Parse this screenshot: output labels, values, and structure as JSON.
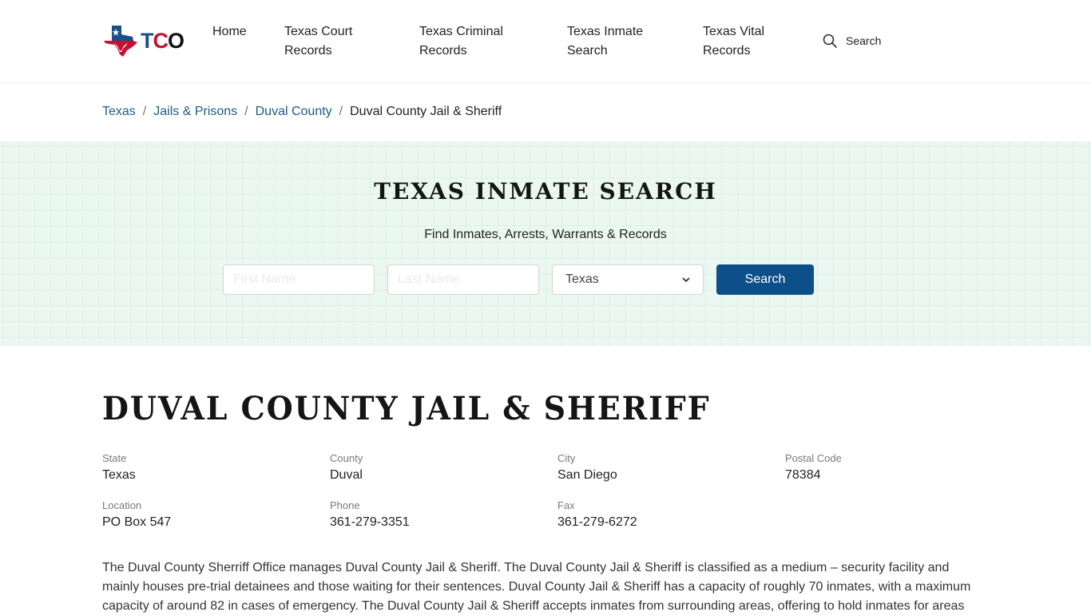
{
  "header": {
    "logo": {
      "text_t": "T",
      "text_c": "C",
      "text_o": "O",
      "colors": {
        "blue": "#1d4e8c",
        "red": "#c8102e",
        "black": "#111111"
      }
    },
    "nav": [
      {
        "line1": "Home",
        "line2": ""
      },
      {
        "line1": "Texas Court",
        "line2": "Records"
      },
      {
        "line1": "Texas Criminal",
        "line2": "Records"
      },
      {
        "line1": "Texas Inmate",
        "line2": "Search"
      },
      {
        "line1": "Texas Vital",
        "line2": "Records"
      }
    ],
    "search_label": "Search",
    "search_icon": "search-icon"
  },
  "breadcrumb": {
    "items": [
      "Texas",
      "Jails & Prisons",
      "Duval County"
    ],
    "separator": "/",
    "current": "Duval County Jail & Sheriff"
  },
  "hero": {
    "title": "TEXAS INMATE SEARCH",
    "subtitle": "Find Inmates, Arrests, Warrants & Records",
    "first_name_placeholder": "First Name",
    "last_name_placeholder": "Last Name",
    "state_selected": "Texas",
    "search_button": "Search",
    "colors": {
      "background": "#eaf8f1",
      "button": "#0d4f89"
    }
  },
  "main": {
    "title": "DUVAL COUNTY JAIL & SHERIFF",
    "info": [
      {
        "label": "State",
        "value": "Texas"
      },
      {
        "label": "County",
        "value": "Duval"
      },
      {
        "label": "City",
        "value": "San Diego"
      },
      {
        "label": "Postal Code",
        "value": "78384"
      },
      {
        "label": "Location",
        "value": "PO Box 547"
      },
      {
        "label": "Phone",
        "value": "361-279-3351"
      },
      {
        "label": "Fax",
        "value": "361-279-6272"
      }
    ],
    "description": "The Duval County Sherriff Office manages Duval County Jail & Sheriff. The Duval County Jail & Sheriff is classified as a medium – security facility and mainly houses pre-trial detainees and those waiting for their sentences. Duval County Jail & Sheriff has a capacity of roughly 70 inmates, with a maximum capacity of around 82 in cases of emergency. The Duval County Jail & Sheriff accepts inmates from surrounding areas, offering to hold inmates for areas"
  }
}
